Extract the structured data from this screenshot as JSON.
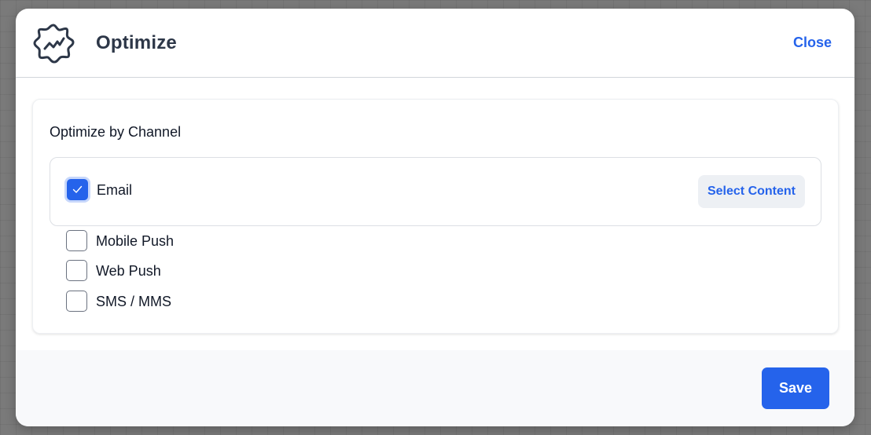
{
  "header": {
    "title": "Optimize",
    "icon": "optimize-badge-icon",
    "close_label": "Close"
  },
  "card": {
    "title": "Optimize by Channel",
    "channels": [
      {
        "label": "Email",
        "checked": true,
        "action_label": "Select Content"
      },
      {
        "label": "Mobile Push",
        "checked": false
      },
      {
        "label": "Web Push",
        "checked": false
      },
      {
        "label": "SMS / MMS",
        "checked": false
      }
    ]
  },
  "footer": {
    "save_label": "Save"
  },
  "colors": {
    "accent": "#2563eb",
    "title_text": "#2d3748",
    "body_text": "#111827",
    "footer_bg": "#f8f9fb",
    "secondary_button_bg": "#edf0f4"
  }
}
